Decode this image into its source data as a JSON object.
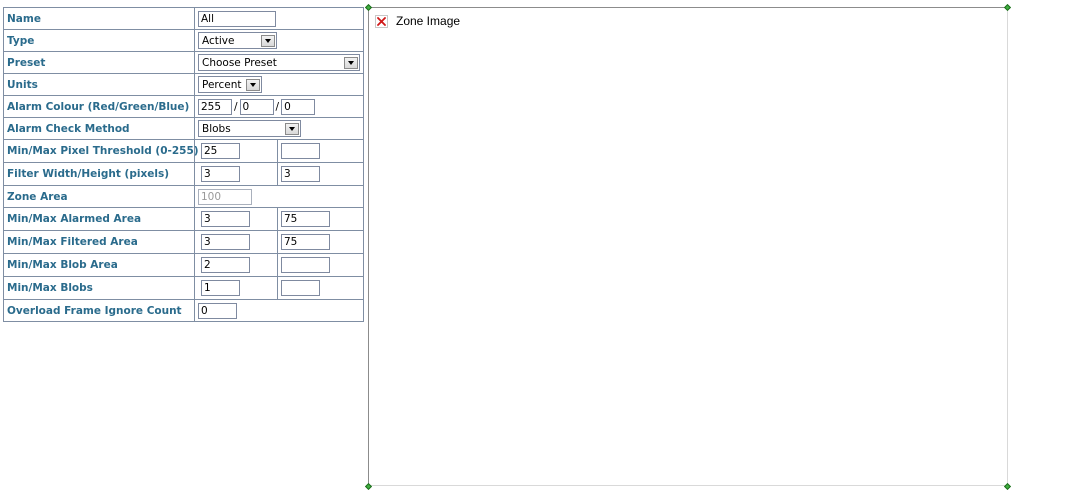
{
  "form": {
    "name": {
      "label": "Name",
      "value": "All"
    },
    "type": {
      "label": "Type",
      "value": "Active"
    },
    "preset": {
      "label": "Preset",
      "value": "Choose Preset"
    },
    "units": {
      "label": "Units",
      "value": "Percent"
    },
    "alarm_colour": {
      "label": "Alarm Colour (Red/Green/Blue)",
      "red": "255",
      "green": "0",
      "blue": "0",
      "separator": "/"
    },
    "check_method": {
      "label": "Alarm Check Method",
      "value": "Blobs"
    },
    "pixel_threshold": {
      "label": "Min/Max Pixel Threshold (0-255)",
      "min": "25",
      "max": ""
    },
    "filter_size": {
      "label": "Filter Width/Height (pixels)",
      "width": "3",
      "height": "3"
    },
    "zone_area": {
      "label": "Zone Area",
      "value": "100"
    },
    "alarmed_area": {
      "label": "Min/Max Alarmed Area",
      "min": "3",
      "max": "75"
    },
    "filtered_area": {
      "label": "Min/Max Filtered Area",
      "min": "3",
      "max": "75"
    },
    "blob_area": {
      "label": "Min/Max Blob Area",
      "min": "2",
      "max": ""
    },
    "blobs": {
      "label": "Min/Max Blobs",
      "min": "1",
      "max": ""
    },
    "overload": {
      "label": "Overload Frame Ignore Count",
      "value": "0"
    }
  },
  "zone_image": {
    "alt_text": "Zone Image",
    "icon": "broken-image-icon"
  },
  "colors": {
    "label": "#2a6b8c",
    "border": "#7f8ea3",
    "handle": "#3fae3f"
  }
}
